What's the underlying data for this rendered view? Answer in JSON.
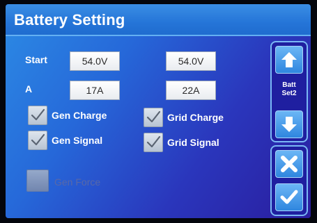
{
  "screen": {
    "title": "Battery Setting"
  },
  "form": {
    "start_label": "Start",
    "a_label": "A",
    "gen_start_value": "54.0V",
    "grid_start_value": "54.0V",
    "gen_a_value": "17A",
    "grid_a_value": "22A"
  },
  "options": {
    "gen_charge": {
      "label": "Gen Charge",
      "checked": true
    },
    "grid_charge": {
      "label": "Grid Charge",
      "checked": true
    },
    "gen_signal": {
      "label": "Gen Signal",
      "checked": true
    },
    "grid_signal": {
      "label": "Grid Signal",
      "checked": true
    },
    "gen_force": {
      "label": "Gen Force",
      "checked": false,
      "enabled": false
    }
  },
  "sidebar": {
    "page_label_line1": "Batt",
    "page_label_line2": "Set2",
    "up_icon": "arrow-up-icon",
    "down_icon": "arrow-down-icon",
    "cancel_icon": "close-icon",
    "confirm_icon": "checkmark-icon"
  },
  "colors": {
    "title_bar": "#2575d8",
    "panel_border": "#7ab8f4",
    "button_face": "#3f96e6"
  }
}
